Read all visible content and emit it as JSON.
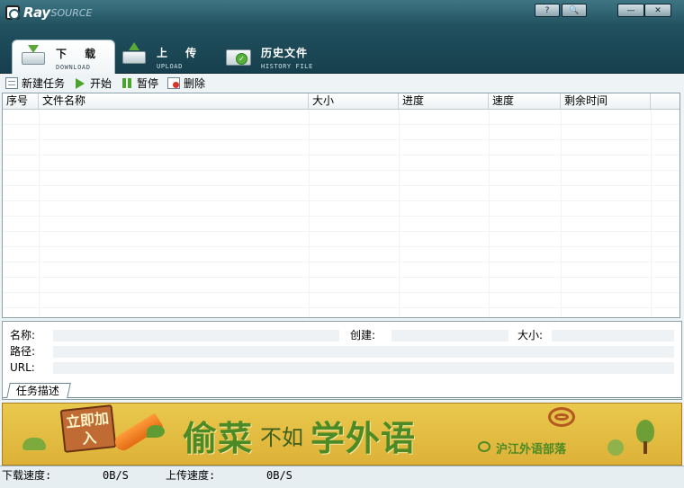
{
  "app": {
    "logo_primary": "Ray",
    "logo_secondary": "SOURCE",
    "window_buttons": {
      "help": "?",
      "search": "🔍",
      "minimize": "—",
      "close": "✕"
    }
  },
  "tabs": [
    {
      "title": "下 载",
      "subtitle": "DOWNLOAD",
      "active": true
    },
    {
      "title": "上 传",
      "subtitle": "UPLOAD",
      "active": false
    },
    {
      "title": "历史文件",
      "subtitle": "HISTORY FILE",
      "active": false
    }
  ],
  "toolbar": {
    "new_task": "新建任务",
    "start": "开始",
    "pause": "暂停",
    "delete": "删除"
  },
  "table": {
    "columns": [
      "序号",
      "文件名称",
      "大小",
      "进度",
      "速度",
      "剩余时间"
    ],
    "rows": []
  },
  "details": {
    "name_label": "名称:",
    "created_label": "创建:",
    "size_label": "大小:",
    "path_label": "路径:",
    "url_label": "URL:",
    "name_value": "",
    "created_value": "",
    "size_value": "",
    "path_value": "",
    "url_value": "",
    "tab_label": "任务描述"
  },
  "banner": {
    "sign_text": "立即加入",
    "headline_1": "偷菜",
    "headline_mid": "不如",
    "headline_2": "学外语",
    "brand": "沪江外语部落",
    "colors": {
      "background": "#e3c04a",
      "accent": "#4c8a25"
    }
  },
  "status": {
    "download_label": "下载速度:",
    "download_value": "0B/S",
    "upload_label": "上传速度:",
    "upload_value": "0B/S"
  }
}
